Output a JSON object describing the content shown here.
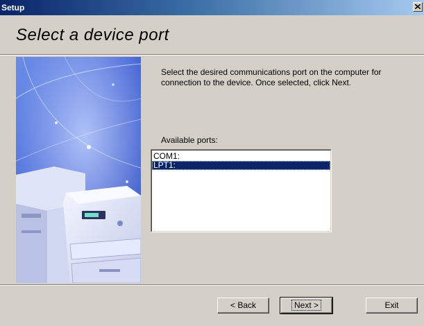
{
  "window": {
    "title": "Setup"
  },
  "page": {
    "heading": "Select a device port",
    "description": "Select the desired communications port on the computer for connection to the device. Once selected, click Next.",
    "ports_label": "Available ports:"
  },
  "ports": {
    "items": [
      "COM1:",
      "LPT1:"
    ],
    "selected": "LPT1:"
  },
  "buttons": {
    "back_label": "< Back",
    "next_label": "Next >",
    "exit_label": "Exit"
  },
  "colors": {
    "selection": "#0a246a",
    "title_bar_start": "#0a246a",
    "dialog_face": "#d4d0c8"
  }
}
